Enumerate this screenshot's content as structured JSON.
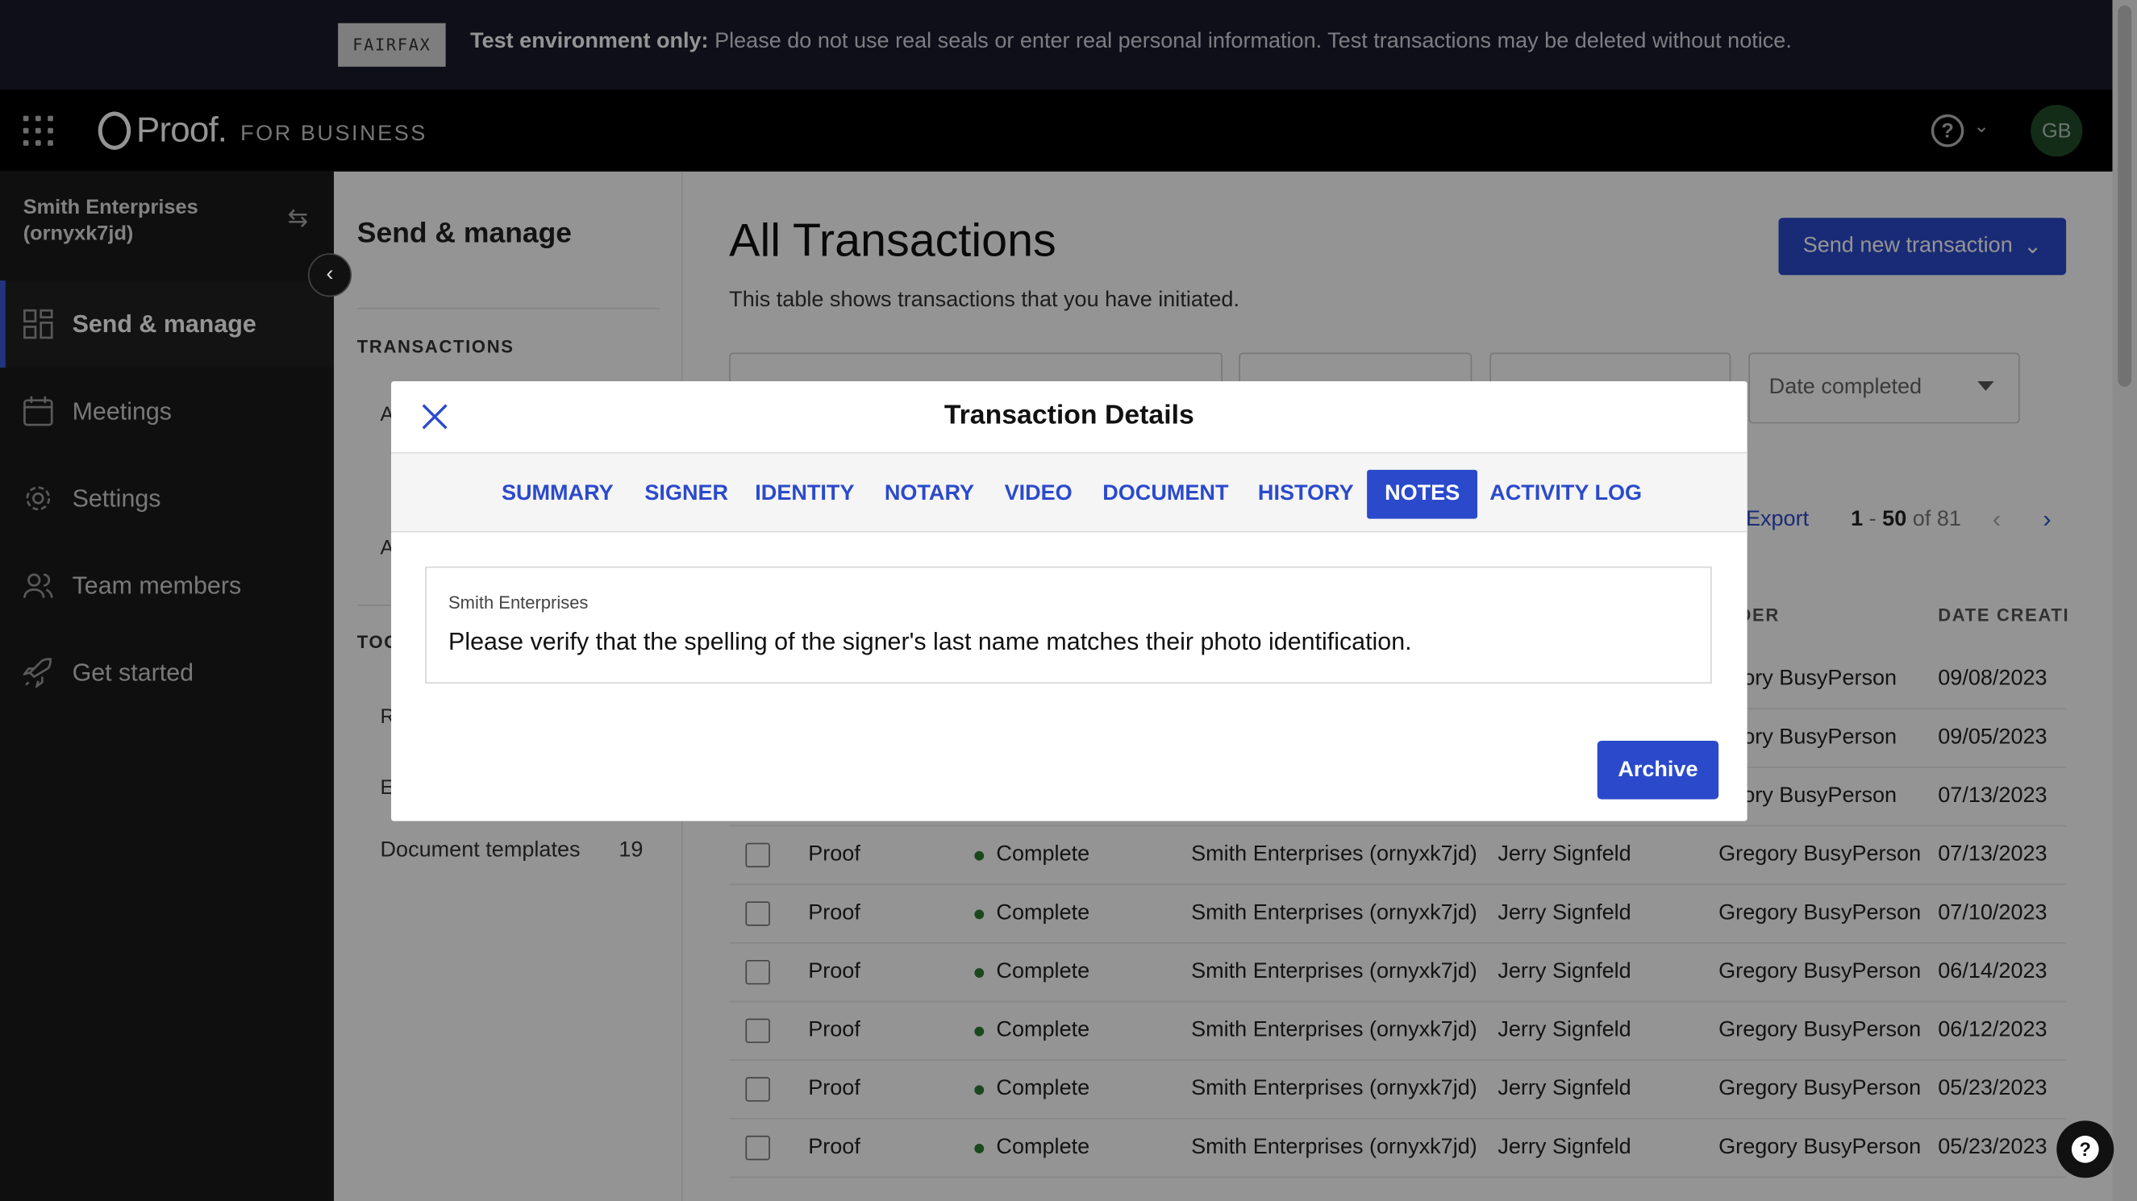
{
  "banner": {
    "logo": "FAIRFAX",
    "bold": "Test environment only:",
    "text": " Please do not use real seals or enter real personal information. Test transactions may be deleted without notice."
  },
  "topbar": {
    "brand": "Proof.",
    "sub": "FOR BUSINESS",
    "avatar": "GB",
    "help": "?"
  },
  "sidebar": {
    "org": "Smith Enterprises (ornyxk7jd)",
    "items": [
      {
        "label": "Send & manage",
        "icon": "dashboard-icon"
      },
      {
        "label": "Meetings",
        "icon": "calendar-icon"
      },
      {
        "label": "Settings",
        "icon": "gear-icon"
      },
      {
        "label": "Team members",
        "icon": "people-icon"
      },
      {
        "label": "Get started",
        "icon": "rocket-icon"
      }
    ]
  },
  "subnav": {
    "title": "Send & manage",
    "section": "TRANSACTIONS",
    "stub_a1": "A",
    "stub_a2": "A",
    "section2": "TOO",
    "stub_r": "R",
    "stub_e": "E",
    "doc_label": "Document templates",
    "doc_count": "19"
  },
  "main": {
    "title": "All Transactions",
    "desc": "This table shows transactions that you have initiated.",
    "send_btn": "Send new transaction",
    "date_filter": "Date completed",
    "export": "Export",
    "paging_start": "1",
    "paging_end": "50",
    "paging_total": "of 81",
    "headers": {
      "sender": "NDER",
      "date": "DATE CREATI"
    },
    "rows": [
      {
        "org": "",
        "signer": "",
        "sender": "egory BusyPerson",
        "date": "09/08/2023"
      },
      {
        "org": "",
        "signer": "",
        "sender": "egory BusyPerson",
        "date": "09/05/2023"
      },
      {
        "org": "",
        "signer": "",
        "sender": "egory BusyPerson",
        "date": "07/13/2023"
      },
      {
        "type": "Proof",
        "status": "Complete",
        "org": "Smith Enterprises (ornyxk7jd)",
        "signer": "Jerry Signfeld",
        "sender": "Gregory BusyPerson",
        "date": "07/13/2023"
      },
      {
        "type": "Proof",
        "status": "Complete",
        "org": "Smith Enterprises (ornyxk7jd)",
        "signer": "Jerry Signfeld",
        "sender": "Gregory BusyPerson",
        "date": "07/10/2023"
      },
      {
        "type": "Proof",
        "status": "Complete",
        "org": "Smith Enterprises (ornyxk7jd)",
        "signer": "Jerry Signfeld",
        "sender": "Gregory BusyPerson",
        "date": "06/14/2023"
      },
      {
        "type": "Proof",
        "status": "Complete",
        "org": "Smith Enterprises (ornyxk7jd)",
        "signer": "Jerry Signfeld",
        "sender": "Gregory BusyPerson",
        "date": "06/12/2023"
      },
      {
        "type": "Proof",
        "status": "Complete",
        "org": "Smith Enterprises (ornyxk7jd)",
        "signer": "Jerry Signfeld",
        "sender": "Gregory BusyPerson",
        "date": "05/23/2023"
      },
      {
        "type": "Proof",
        "status": "Complete",
        "org": "Smith Enterprises (ornyxk7jd)",
        "signer": "Jerry Signfeld",
        "sender": "Gregory BusyPerson",
        "date": "05/23/2023"
      }
    ]
  },
  "modal": {
    "title": "Transaction Details",
    "tabs": [
      "SUMMARY",
      "SIGNER",
      "IDENTITY",
      "NOTARY",
      "VIDEO",
      "DOCUMENT",
      "HISTORY",
      "NOTES",
      "ACTIVITY LOG"
    ],
    "active_tab": "NOTES",
    "note_author": "Smith Enterprises",
    "note_body": "Please verify that the spelling of the signer's last name matches their photo identification.",
    "archive": "Archive"
  },
  "colors": {
    "accent": "#2b4acb",
    "banner_bg": "#1a1a2e",
    "sidebar_bg": "#1a1a1a",
    "status_green": "#2e7d32"
  }
}
